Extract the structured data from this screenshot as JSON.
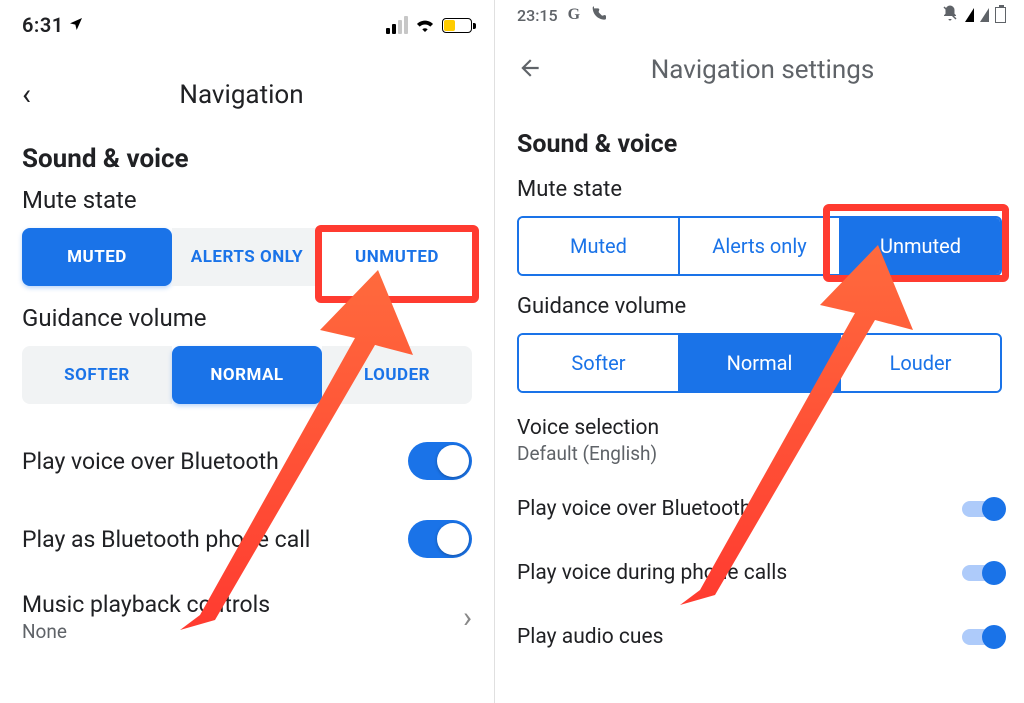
{
  "left": {
    "status_time": "6:31",
    "header_title": "Navigation",
    "section_title": "Sound & voice",
    "mute_label": "Mute state",
    "mute_options": {
      "muted": "MUTED",
      "alerts": "ALERTS ONLY",
      "unmuted": "UNMUTED"
    },
    "volume_label": "Guidance volume",
    "volume_options": {
      "softer": "SOFTER",
      "normal": "NORMAL",
      "louder": "LOUDER"
    },
    "bt_voice": "Play voice over Bluetooth",
    "bt_call": "Play as Bluetooth phone call",
    "music_row": "Music playback controls",
    "music_sub": "None"
  },
  "right": {
    "status_time": "23:15",
    "header_title": "Navigation settings",
    "section_title": "Sound & voice",
    "mute_label": "Mute state",
    "mute_options": {
      "muted": "Muted",
      "alerts": "Alerts only",
      "unmuted": "Unmuted"
    },
    "volume_label": "Guidance volume",
    "volume_options": {
      "softer": "Softer",
      "normal": "Normal",
      "louder": "Louder"
    },
    "voice_sel": "Voice selection",
    "voice_sel_sub": "Default (English)",
    "bt_voice": "Play voice over Bluetooth",
    "during_calls": "Play voice during phone calls",
    "audio_cues": "Play audio cues"
  }
}
